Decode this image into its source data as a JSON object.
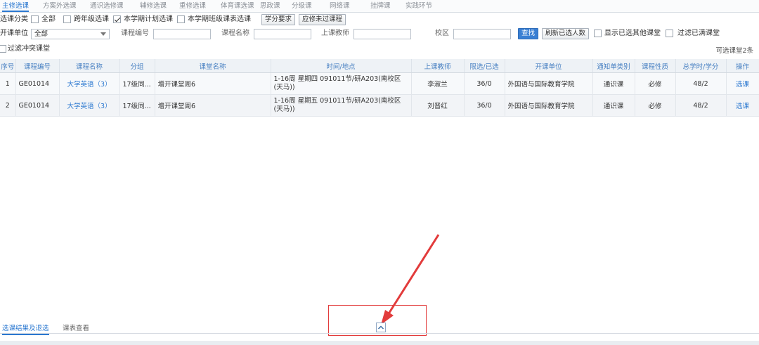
{
  "tabs": [
    "主修选课",
    "方案外选课",
    "通识选修课",
    "辅修选课",
    "重修选课",
    "体育课选课",
    "思政课",
    "分级课",
    "网络课",
    "挂牌课",
    "实践环节"
  ],
  "filters": {
    "category_label": "选课分类",
    "all": "全部",
    "cross_grade": "跨年级选课",
    "plan_courses": "本学期计划选课",
    "class_schedule": "本学期班级课表选课",
    "credit_btn": "学分要求",
    "failed_btn": "应修未过课程",
    "dept_label": "开课单位",
    "dept_value": "全部",
    "code_label": "课程编号",
    "name_label": "课程名称",
    "teacher_label": "上课教师",
    "campus_label": "校区",
    "search_btn": "查找",
    "refresh_btn": "刷新已选人数",
    "show_other": "显示已选其他课堂",
    "filter_full": "过滤已满课堂",
    "filter_conflict": "过滤冲突课堂"
  },
  "count_text": "可选课堂2条",
  "table": {
    "headers": [
      "序号",
      "课程编号",
      "课程名称",
      "分组",
      "课堂名称",
      "时间/地点",
      "上课教师",
      "限选/已选",
      "开课单位",
      "通知单类别",
      "课程性质",
      "总学时/学分",
      "操作"
    ],
    "rows": [
      [
        "1",
        "GE01014",
        "大学英语（3）",
        "17级同...",
        "增开课堂周6",
        "1-16周 星期四 091011节/研A203(南校区(天马))",
        "李淑兰",
        "36/0",
        "外国语与国际教育学院",
        "通识课",
        "必修",
        "48/2",
        "选课"
      ],
      [
        "2",
        "GE01014",
        "大学英语（3）",
        "17级同...",
        "增开课堂周6",
        "1-16周 星期五 091011节/研A203(南校区(天马))",
        "刘晋红",
        "36/0",
        "外国语与国际教育学院",
        "通识课",
        "必修",
        "48/2",
        "选课"
      ]
    ]
  },
  "bottom_tabs": [
    "选课结果及退选",
    "课表查看"
  ],
  "colors": {
    "accent": "#2b78d0",
    "annotation": "#e23b3b"
  }
}
